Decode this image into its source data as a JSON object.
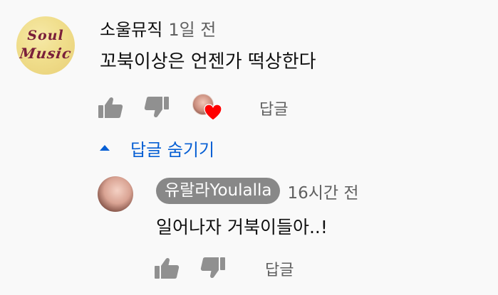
{
  "comment": {
    "author": "소울뮤직",
    "time": "1일 전",
    "text": "꼬북이상은 언젠가 떡상한다",
    "avatar_logo": [
      "Soul",
      "Music"
    ],
    "reply_label": "답글"
  },
  "replies_toggle": {
    "label": "답글 숨기기"
  },
  "reply": {
    "author": "유랄라Youlalla",
    "time": "16시간 전",
    "text": "일어나자 거북이들아..!",
    "reply_label": "답글"
  },
  "colors": {
    "link_blue": "#065fd4",
    "icon_gray": "#909090",
    "heart_red": "#ff0000",
    "badge_gray": "#888888"
  }
}
